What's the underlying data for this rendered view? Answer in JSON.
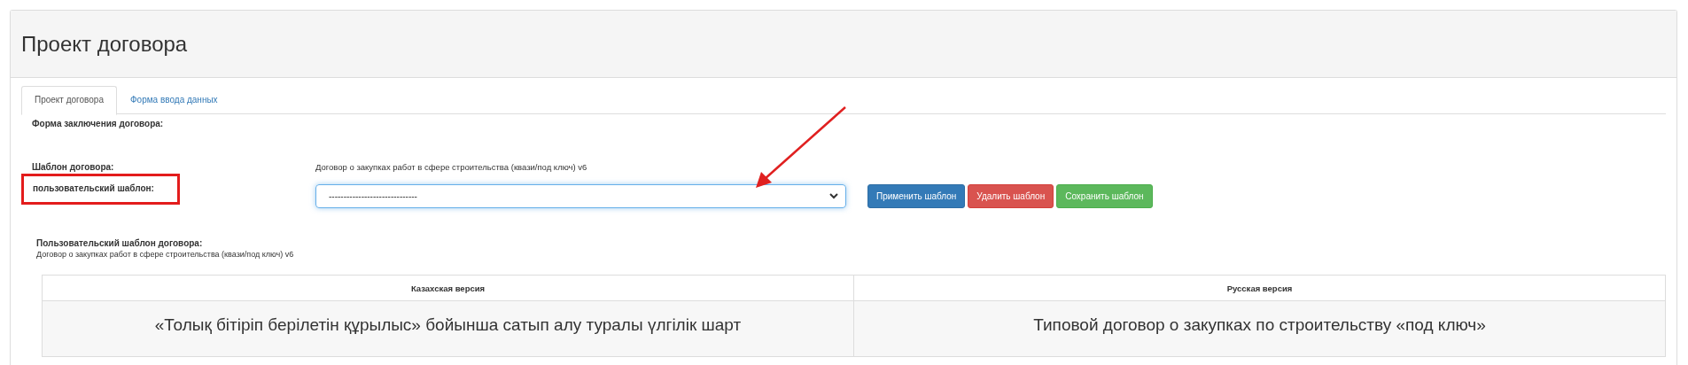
{
  "panel": {
    "title": "Проект договора"
  },
  "tabs": [
    {
      "label": "Проект договора",
      "selected": true
    },
    {
      "label": "Форма ввода данных",
      "selected": false
    }
  ],
  "form": {
    "contract_form_label": "Форма заключения договора:",
    "template_label": "Шаблон договора:",
    "template_value": "Договор о закупках работ в сфере строительства (квази/под ключ) v6",
    "user_template_label": "пользовательский шаблон:",
    "user_template_select": {
      "value": "------------------------------"
    },
    "buttons": [
      {
        "label": "Применить шаблон",
        "kind": "primary"
      },
      {
        "label": "Удалить шаблон",
        "kind": "danger"
      },
      {
        "label": "Сохранить шаблон",
        "kind": "success"
      }
    ]
  },
  "user_template_section": {
    "label": "Пользовательский шаблон договора:",
    "value": "Договор о закупках работ в сфере строительства (квази/под ключ) v6"
  },
  "table": {
    "columns": [
      "Казахская версия",
      "Русская версия"
    ],
    "rows": [
      [
        "«Толық бітіріп берілетін құрылыс» бойынша сатып алу туралы үлгілік шарт",
        "Типовой договор о закупках по строительству «под ключ»"
      ]
    ]
  }
}
